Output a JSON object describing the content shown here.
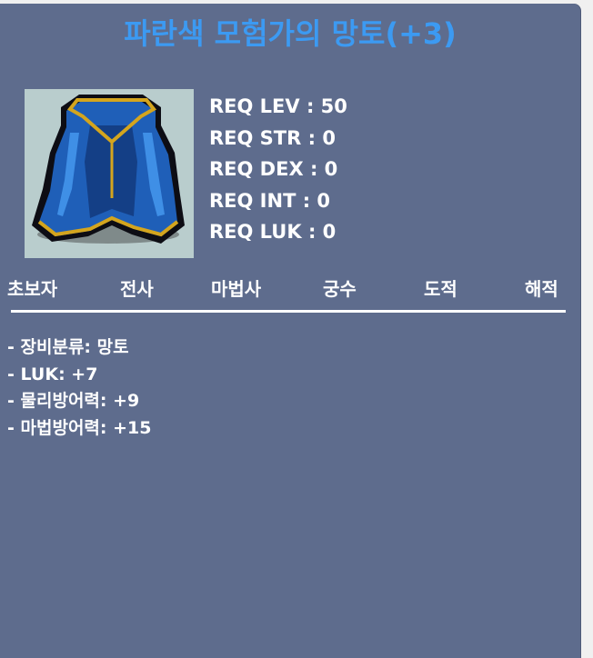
{
  "item": {
    "name": "파란색 모험가의 망토(+3)",
    "icon": "blue-cape-icon"
  },
  "requirements": [
    {
      "label": "REQ LEV : 50"
    },
    {
      "label": "REQ STR : 0"
    },
    {
      "label": "REQ DEX : 0"
    },
    {
      "label": "REQ INT : 0"
    },
    {
      "label": "REQ LUK : 0"
    }
  ],
  "jobs": [
    "초보자",
    "전사",
    "마법사",
    "궁수",
    "도적",
    "해적"
  ],
  "stats": [
    "- 장비분류: 망토",
    "- LUK: +7",
    "- 물리방어력: +9",
    "- 마법방어력: +15"
  ],
  "colors": {
    "panel": "#5e6c8d",
    "title": "#3c9af2",
    "text": "#ffffff",
    "cape_blue": "#1f5fb8",
    "cape_gold": "#d4a51e"
  }
}
